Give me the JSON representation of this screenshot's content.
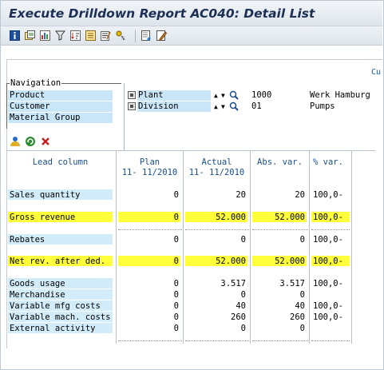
{
  "window": {
    "title": "Execute Drilldown Report AC040: Detail List"
  },
  "toolbar_icons": [
    "info-icon",
    "detail-icon",
    "chart-icon",
    "filter-icon",
    "sort-icon",
    "export-icon",
    "layout-icon",
    "settings-icon",
    "print-icon",
    "edit-icon"
  ],
  "header_fragment": "Cu",
  "navigation": {
    "title": "Navigation",
    "items": [
      "Product",
      "Customer",
      "Material Group"
    ]
  },
  "characteristics": [
    {
      "name": "Plant",
      "value": "1000",
      "description": "Werk Hamburg"
    },
    {
      "name": "Division",
      "value": "01",
      "description": "Pumps"
    }
  ],
  "table": {
    "lead_header": "Lead column",
    "columns": [
      {
        "line1": "Plan",
        "line2": "11- 11/2010"
      },
      {
        "line1": "Actual",
        "line2": "11- 11/2010"
      },
      {
        "line1": "Abs. var.",
        "line2": ""
      },
      {
        "line1": "% var.",
        "line2": ""
      }
    ],
    "rows": [
      {
        "label": "Sales quantity",
        "plan": "0",
        "actual": "20",
        "abs": "20",
        "pct": "100,0-"
      },
      {
        "label": "Gross revenue",
        "plan": "0",
        "actual": "52.000",
        "abs": "52.000",
        "pct": "100,0-"
      },
      {
        "label": "Rebates",
        "plan": "0",
        "actual": "0",
        "abs": "0",
        "pct": "100,0-"
      },
      {
        "label": "Net rev. after ded.",
        "plan": "0",
        "actual": "52.000",
        "abs": "52.000",
        "pct": "100,0-"
      },
      {
        "label": "Goods usage",
        "plan": "0",
        "actual": "3.517",
        "abs": "3.517",
        "pct": "100,0-"
      },
      {
        "label": "Merchandise",
        "plan": "0",
        "actual": "0",
        "abs": "0",
        "pct": ""
      },
      {
        "label": "Variable mfg costs",
        "plan": "0",
        "actual": "40",
        "abs": "40",
        "pct": "100,0-"
      },
      {
        "label": "Variable mach. costs",
        "plan": "0",
        "actual": "260",
        "abs": "260",
        "pct": "100,0-"
      },
      {
        "label": "External activity",
        "plan": "0",
        "actual": "0",
        "abs": "0",
        "pct": ""
      }
    ]
  },
  "colors": {
    "highlight": "#ffff3c",
    "label_bg": "#d2ecfa",
    "title": "#1c2f55",
    "header_text": "#1a4f8a"
  }
}
